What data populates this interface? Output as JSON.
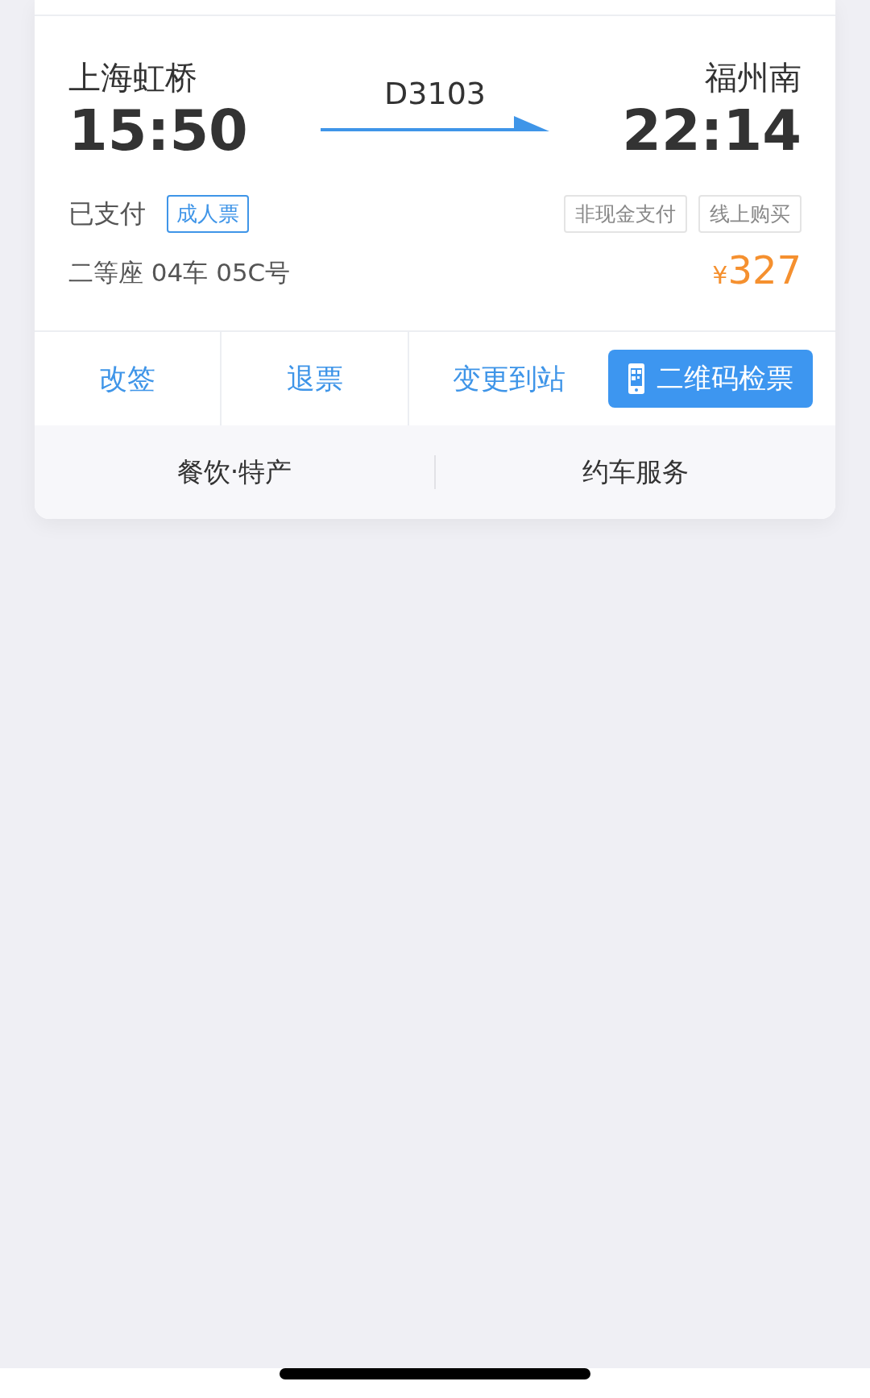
{
  "ticket": {
    "departure": {
      "station": "上海虹桥",
      "time": "15:50"
    },
    "train_number": "D3103",
    "arrival": {
      "station": "福州南",
      "time": "22:14"
    },
    "payment_status": "已支付",
    "ticket_type": "成人票",
    "seat": "二等座 04车 05C号",
    "tags": [
      "非现金支付",
      "线上购买"
    ],
    "price": {
      "currency": "¥",
      "amount": "327"
    }
  },
  "actions": [
    {
      "label": "改签",
      "kind": "link"
    },
    {
      "label": "退票",
      "kind": "link"
    },
    {
      "label": "变更到站",
      "kind": "link"
    },
    {
      "label": "二维码检票",
      "kind": "primary"
    }
  ],
  "services": [
    "餐饮·特产",
    "约车服务"
  ]
}
